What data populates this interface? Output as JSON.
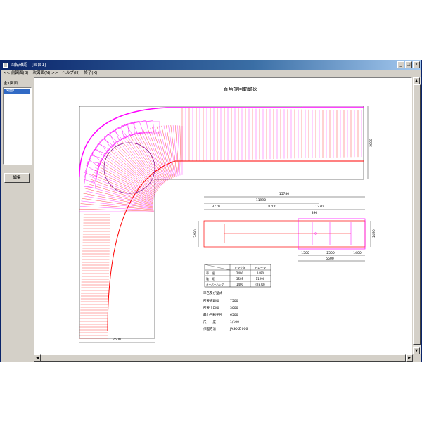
{
  "window": {
    "title": "回転確認 - [図面1]"
  },
  "window_buttons": {
    "minimize": "_",
    "maximize": "□",
    "close": "×"
  },
  "menu": [
    "<< 前図面(B)",
    "次図面(N) >>",
    "ヘルプ(H)",
    "終了(X)"
  ],
  "sidebar": {
    "title": "全1図面",
    "items": [
      "図面1"
    ],
    "edit_button": "編集"
  },
  "drawing": {
    "title": "直角旋回軌跡図",
    "road_width_dim": "7500",
    "road_right_dim": "2800",
    "vehicle_dims": {
      "overall": "15780",
      "trailer": "11990",
      "tractor": "3770",
      "wheelbase": "8700",
      "rear": "1270",
      "kingpin_gap": "390",
      "width": "2490",
      "axle1": "1500",
      "axle2": "2500",
      "axle3": "1400",
      "rear_total": "5500"
    },
    "table": {
      "headers": [
        "",
        "トラクタ",
        "トレーラ"
      ],
      "rows": [
        [
          "車　幅",
          "2490",
          "2490"
        ],
        [
          "軸　距",
          "3505",
          "11990"
        ],
        [
          "オーバーハング",
          "1400",
          "(2870)"
        ]
      ]
    },
    "notes_title": "車名及び型式",
    "notes": [
      {
        "label": "所要道路幅",
        "value": "7500"
      },
      {
        "label": "所要出口幅",
        "value": "3000"
      },
      {
        "label": "最小回転半径",
        "value": "6500"
      },
      {
        "label": "尺　　度",
        "value": "1/100"
      },
      {
        "label": "作図方法",
        "value": "JASO Z 006"
      }
    ]
  },
  "colors": {
    "sweep_red": "#ff0000",
    "sweep_magenta": "#ff00ff",
    "circle_purple": "#800080",
    "titlebar": "#0a246a",
    "selection": "#316ac5"
  },
  "scrollbars": {
    "left": "◀",
    "right": "▶",
    "up": "▲",
    "down": "▼"
  }
}
